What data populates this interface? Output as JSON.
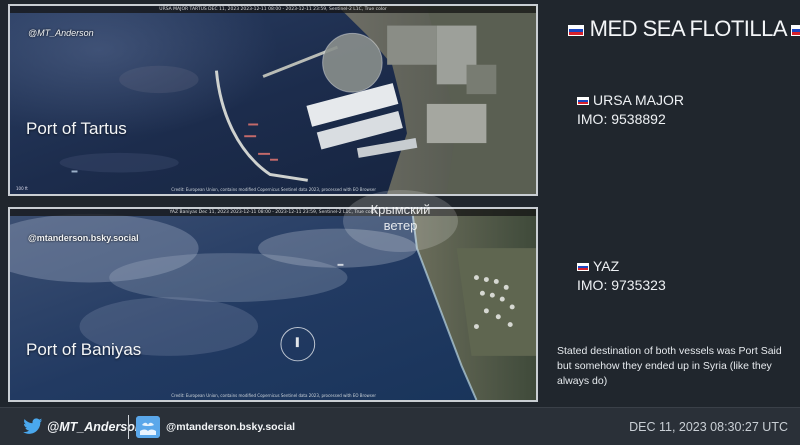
{
  "header": {
    "title": "MED SEA FLOTILLA",
    "flag_icon": "russia-flag-icon"
  },
  "panels": [
    {
      "handle": "@MT_Anderson",
      "port": "Port of Tartus",
      "strip_text": "URSA MAJOR TARTUS DEC 11, 2023  2023-12-11 08:00 - 2023-12-11 23:59, Sentinel-2 L1C, True color",
      "credit": "Credit: European Union, contains modified Copernicus Sentinel data 2023, processed with EO Browser",
      "scale": "100 ft"
    },
    {
      "handle": "@mtanderson.bsky.social",
      "port": "Port of Baniyas",
      "strip_text": "YAZ Baniyas Dec 11, 2023  2023-12-11 08:00 - 2023-12-11 23:59, Sentinel-2 L1C, True color",
      "credit": "Credit: European Union, contains modified Copernicus Sentinel data 2023, processed with EO Browser",
      "scale": ""
    }
  ],
  "vessels": [
    {
      "name": "URSA MAJOR",
      "imo": "IMO: 9538892",
      "flag_icon": "russia-flag-icon"
    },
    {
      "name": "YAZ",
      "imo": "IMO: 9735323",
      "flag_icon": "russia-flag-icon"
    }
  ],
  "note": "Stated destination of both vessels was Port Said but somehow they ended up in Syria (like they always do)",
  "watermark": {
    "line1": "Крымский",
    "line2": "ветер"
  },
  "footer": {
    "twitter_handle": "@MT_Anderson",
    "twitter_icon": "twitter-bird-icon",
    "bluesky_handle": "@mtanderson.bsky.social",
    "bluesky_icon": "bluesky-icon",
    "timestamp": "DEC 11, 2023 08:30:27 UTC"
  },
  "colors": {
    "background": "#20262d",
    "footer": "#2a3038",
    "sea": "#1b2f4f",
    "flag_white": "#ffffff",
    "flag_blue": "#1b46c0",
    "flag_red": "#d7212b"
  }
}
